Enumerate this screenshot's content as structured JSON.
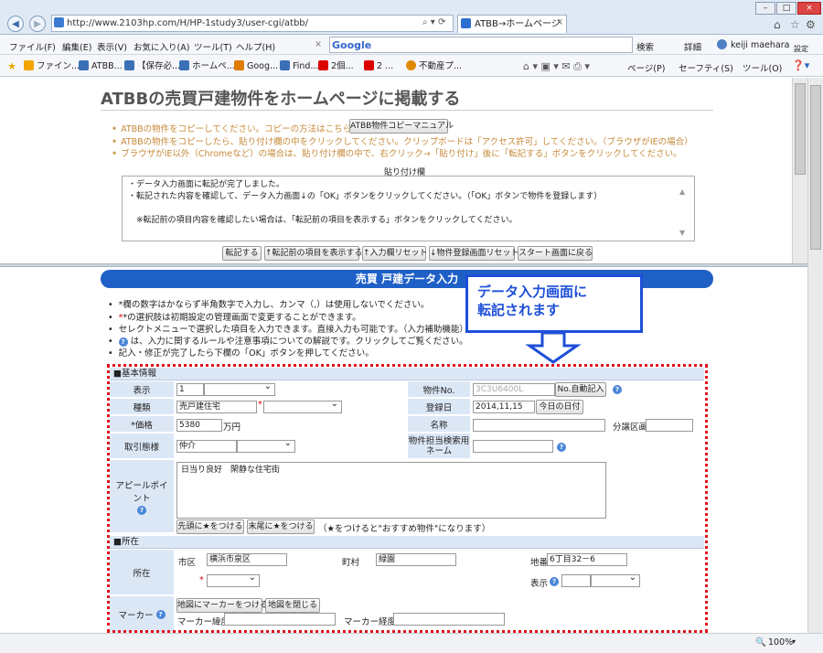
{
  "browser": {
    "url": "http://www.2103hp.com/H/HP-1study3/user-cgi/atbb/",
    "tab_title": "ATBB→ホームページ",
    "menu": [
      "ファイル(F)",
      "編集(E)",
      "表示(V)",
      "お気に入り(A)",
      "ツール(T)",
      "ヘルプ(H)"
    ],
    "google_label": "Google",
    "search_label": "検索",
    "detail_label": "詳細",
    "user_name": "keiji maehara",
    "settings_label": "設定",
    "favorites": [
      "ファイン...",
      "ATBB...",
      "【保存必...",
      "ホームペ...",
      "Goog...",
      "Find...",
      "2個...",
      "2 ...",
      "不動産プ..."
    ],
    "toolbar_right": [
      "ページ(P)",
      "セーフティ(S)",
      "ツール(O)"
    ],
    "zoom": "100%"
  },
  "top_frame": {
    "title": "ATBBの売買戸建物件をホームページに掲載する",
    "notes": [
      "ATBBの物件をコピーしてください。コピーの方法はこちら→",
      "ATBBの物件をコピーしたら、貼り付け欄の中をクリックしてください。クリップボードは「アクセス許可」してください。（ブラウザがIEの場合）",
      "ブラウザがIE以外（Chromeなど）の場合は、貼り付け欄の中で、右クリック→「貼り付け」後に「転記する」ボタンをクリックしてください。"
    ],
    "copy_manual_button": "ATBB物件コピーマニュアル",
    "paste_label": "貼り付け欄",
    "paste_lines": [
      "・データ入力画面に転記が完了しました。",
      "・転記された内容を確認して、データ入力画面↓の「OK」ボタンをクリックしてください。（「OK」ボタンで物件を登録します）",
      "",
      "　※転記前の項目内容を確認したい場合は、「転記前の項目を表示する」ボタンをクリックしてください。"
    ],
    "buttons": [
      "転記する",
      "↑転記前の項目を表示する",
      "↑入力欄リセット",
      "↓物件登録画面リセット",
      "スタート画面に戻る"
    ]
  },
  "form": {
    "header": "売買 戸建データ入力",
    "bullets": [
      "*欄の数字はかならず半角数字で入力し、カンマ（,）は使用しないでください。",
      "*の選択肢は初期設定の管理画面で変更することができます。",
      "セレクトメニューで選択した項目を入力できます。直接入力も可能です。（入力補助機能）",
      "は、入力に関するルールや注意事項についての解説です。クリックしてご覧ください。",
      "記入・修正が完了したら下欄の「OK」ボタンを押してください。"
    ],
    "callout": "データ入力画面に\n転記されます",
    "section_basic": "■基本情報",
    "labels": {
      "display": "表示",
      "kind": "種類",
      "price": "*価格",
      "deal": "取引態様",
      "appeal": "アピールポイント",
      "bukken_no": "物件No.",
      "reg_date": "登録日",
      "name": "名称",
      "subdivision": "分譲区画",
      "search_name": "物件担当検索用ネーム"
    },
    "values": {
      "display": "1",
      "kind": "売戸建住宅",
      "price": "5380",
      "price_unit": "万円",
      "deal": "仲介",
      "bukken_no": "3C3U6400L",
      "reg_date": "2014,11,15",
      "appeal": "日当り良好　閑静な住宅街"
    },
    "buttons": {
      "auto_no": "No.自動記入",
      "today": "今日の日付",
      "star_head": "先頭に★をつける",
      "star_tail": "末尾に★をつける"
    },
    "star_note": "（★をつけると\"おすすめ物件\"になります）",
    "section_location": "■所在",
    "location": {
      "label": "所在",
      "city_label": "市区",
      "city": "横浜市泉区",
      "town_label": "町村",
      "town": "緑園",
      "lot_label": "地番",
      "lot": "6丁目32－6",
      "display_label": "表示"
    },
    "marker": {
      "label": "マーカー",
      "btn_put": "地図にマーカーをつける",
      "btn_close": "地図を閉じる",
      "lat_label": "マーカー緯度",
      "lng_label": "マーカー経度"
    }
  }
}
